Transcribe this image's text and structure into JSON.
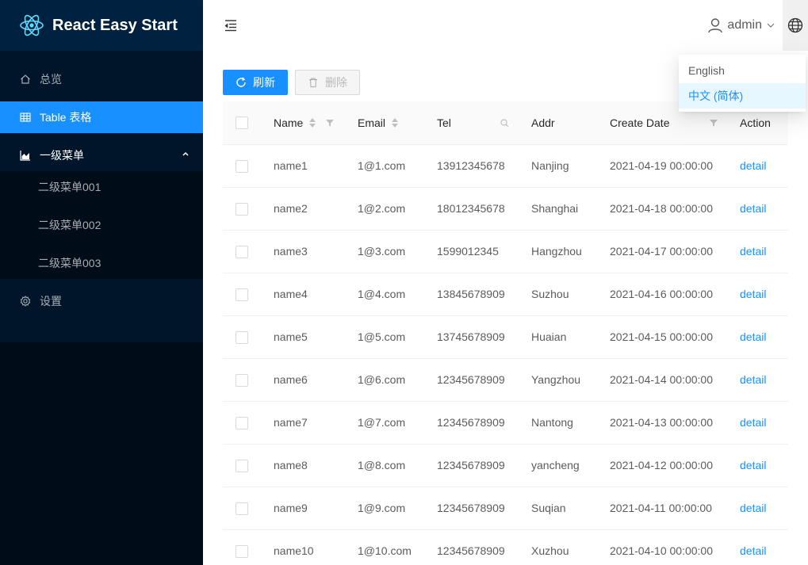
{
  "app": {
    "title": "React Easy Start"
  },
  "sidebar": {
    "items": [
      {
        "label": "总览",
        "icon": "home-icon"
      },
      {
        "label": "Table 表格",
        "icon": "table-icon"
      },
      {
        "label": "一级菜单",
        "icon": "area-chart-icon"
      },
      {
        "label": "设置",
        "icon": "gear-icon"
      }
    ],
    "submenu": [
      {
        "label": "二级菜单001"
      },
      {
        "label": "二级菜单002"
      },
      {
        "label": "二级菜单003"
      }
    ]
  },
  "header": {
    "username": "admin"
  },
  "language_menu": {
    "options": [
      "English",
      "中文 (简体)"
    ],
    "selected": "中文 (简体)"
  },
  "toolbar": {
    "refresh_label": "刷新",
    "delete_label": "删除"
  },
  "table": {
    "columns": [
      "Name",
      "Email",
      "Tel",
      "Addr",
      "Create Date",
      "Action"
    ],
    "rows": [
      {
        "name": "name1",
        "email": "1@1.com",
        "tel": "13912345678",
        "addr": "Nanjing",
        "date": "2021-04-19 00:00:00",
        "action": "detail"
      },
      {
        "name": "name2",
        "email": "1@2.com",
        "tel": "18012345678",
        "addr": "Shanghai",
        "date": "2021-04-18 00:00:00",
        "action": "detail"
      },
      {
        "name": "name3",
        "email": "1@3.com",
        "tel": "1599012345",
        "addr": "Hangzhou",
        "date": "2021-04-17 00:00:00",
        "action": "detail"
      },
      {
        "name": "name4",
        "email": "1@4.com",
        "tel": "13845678909",
        "addr": "Suzhou",
        "date": "2021-04-16 00:00:00",
        "action": "detail"
      },
      {
        "name": "name5",
        "email": "1@5.com",
        "tel": "13745678909",
        "addr": "Huaian",
        "date": "2021-04-15 00:00:00",
        "action": "detail"
      },
      {
        "name": "name6",
        "email": "1@6.com",
        "tel": "12345678909",
        "addr": "Yangzhou",
        "date": "2021-04-14 00:00:00",
        "action": "detail"
      },
      {
        "name": "name7",
        "email": "1@7.com",
        "tel": "12345678909",
        "addr": "Nantong",
        "date": "2021-04-13 00:00:00",
        "action": "detail"
      },
      {
        "name": "name8",
        "email": "1@8.com",
        "tel": "12345678909",
        "addr": "yancheng",
        "date": "2021-04-12 00:00:00",
        "action": "detail"
      },
      {
        "name": "name9",
        "email": "1@9.com",
        "tel": "12345678909",
        "addr": "Suqian",
        "date": "2021-04-11 00:00:00",
        "action": "detail"
      },
      {
        "name": "name10",
        "email": "1@10.com",
        "tel": "12345678909",
        "addr": "Xuzhou",
        "date": "2021-04-10 00:00:00",
        "action": "detail"
      }
    ]
  },
  "colors": {
    "sider_bg": "#001529",
    "logo_bg": "#002140",
    "submenu_bg": "#000c17",
    "primary": "#1890ff"
  }
}
